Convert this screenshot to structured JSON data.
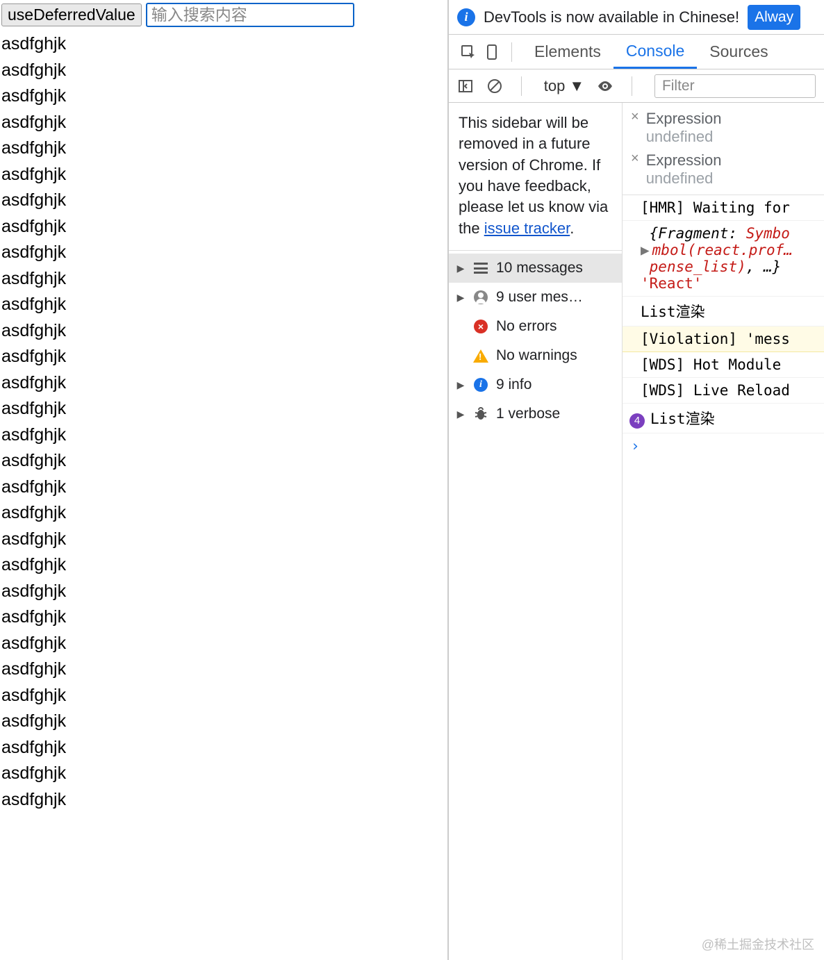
{
  "page": {
    "button_label": "useDeferredValue",
    "search_placeholder": "输入搜索内容",
    "list_text": "asdfghjk",
    "list_count": 30
  },
  "infobar": {
    "text": "DevTools is now available in Chinese!",
    "button": "Alway"
  },
  "tabs": {
    "elements": "Elements",
    "console": "Console",
    "sources": "Sources"
  },
  "toolbar": {
    "context": "top",
    "filter_placeholder": "Filter"
  },
  "sidebar": {
    "notice_pre": "This sidebar will be removed in a future version of Chrome. If you have feedback, please let us know via the ",
    "notice_link": "issue tracker",
    "notice_post": ".",
    "items": [
      {
        "label": "10 messages",
        "icon": "lines",
        "caret": true,
        "selected": true
      },
      {
        "label": "9 user mes…",
        "icon": "user",
        "caret": true,
        "selected": false
      },
      {
        "label": "No errors",
        "icon": "red",
        "caret": false,
        "selected": false
      },
      {
        "label": "No warnings",
        "icon": "warn",
        "caret": false,
        "selected": false
      },
      {
        "label": "9 info",
        "icon": "blue",
        "caret": true,
        "selected": false
      },
      {
        "label": "1 verbose",
        "icon": "bug",
        "caret": true,
        "selected": false
      }
    ]
  },
  "watch": [
    {
      "name": "Expression",
      "value": "undefined"
    },
    {
      "name": "Expression",
      "value": "undefined"
    }
  ],
  "logs": {
    "hmr": "[HMR] Waiting for",
    "obj_l1a": "{Fragment: ",
    "obj_l1b": "Symbo",
    "obj_l2": "mbol(react.prof…",
    "obj_l3a": "pense_list)",
    "obj_l3b": ", …}",
    "obj_l4": "'React'",
    "render1": "List渲染",
    "violation": "[Violation] 'mess",
    "wds1": "[WDS] Hot Module",
    "wds2": "[WDS] Live Reload",
    "render2_badge": "4",
    "render2": "List渲染",
    "prompt": "›"
  },
  "watermark": "@稀土掘金技术社区"
}
